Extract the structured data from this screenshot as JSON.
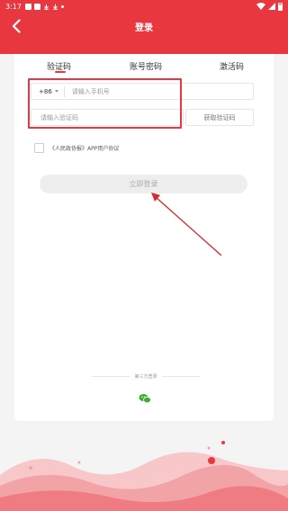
{
  "status_bar": {
    "time": "3:17"
  },
  "header": {
    "title": "登录",
    "background": "#e8373f"
  },
  "tabs": [
    {
      "label": "验证码",
      "active": true
    },
    {
      "label": "账号密码",
      "active": false
    },
    {
      "label": "激活码",
      "active": false
    }
  ],
  "form": {
    "country_code": "+86",
    "phone_placeholder": "请输入手机号",
    "code_placeholder": "请输入验证码",
    "get_code_label": "获取验证码",
    "agreement_text": "《人民政协报》APP用户协议",
    "login_label": "立即登录"
  },
  "third_party": {
    "label": "第三方登录",
    "wechat_icon": "wechat-icon"
  },
  "colors": {
    "accent": "#e8373f",
    "annotation": "#d9262e",
    "wave_light": "#f7c7c9",
    "wave_mid": "#f2a3a6",
    "wave_dark": "#ef7c82"
  }
}
